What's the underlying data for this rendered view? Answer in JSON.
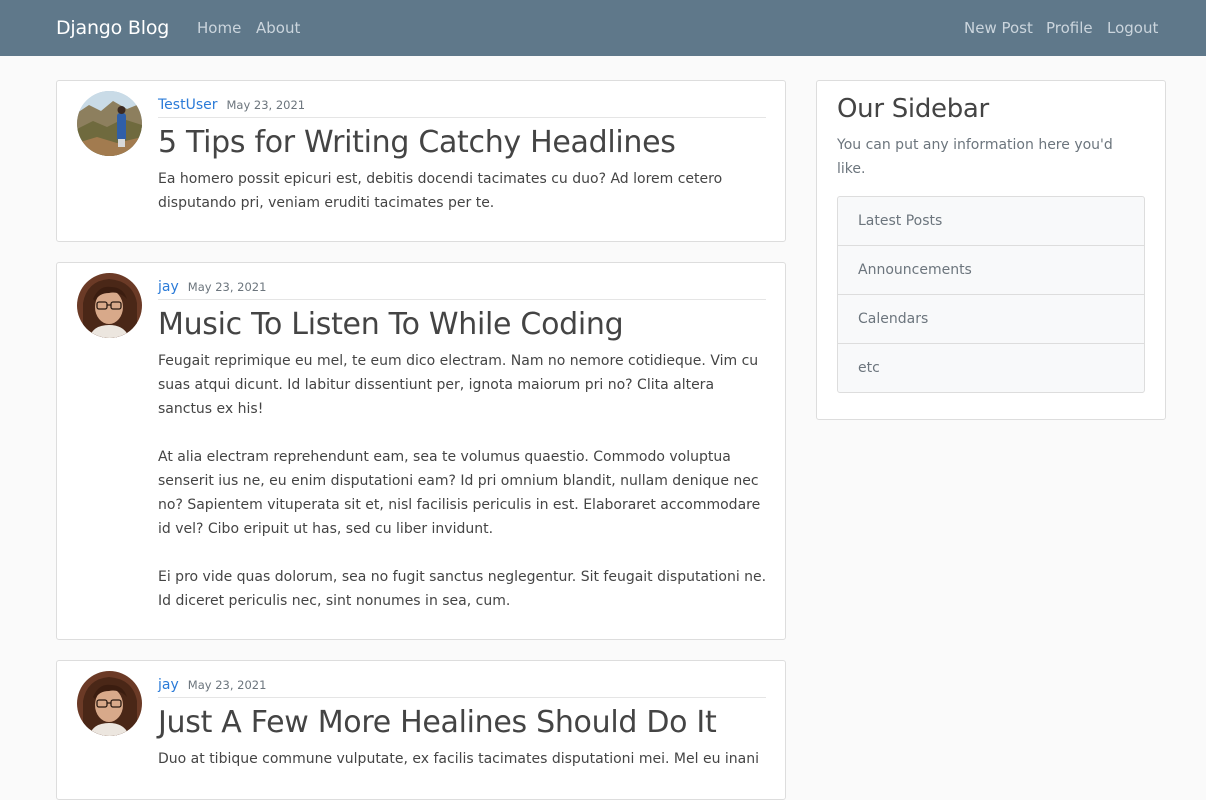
{
  "navbar": {
    "brand": "Django Blog",
    "left_links": [
      "Home",
      "About"
    ],
    "right_links": [
      "New Post",
      "Profile",
      "Logout"
    ]
  },
  "posts": [
    {
      "author": "TestUser",
      "date": "May 23, 2021",
      "title": "5 Tips for Writing Catchy Headlines",
      "paragraphs": [
        "Ea homero possit epicuri est, debitis docendi tacimates cu duo? Ad lorem cetero disputando pri, veniam eruditi tacimates per te."
      ]
    },
    {
      "author": "jay",
      "date": "May 23, 2021",
      "title": "Music To Listen To While Coding",
      "paragraphs": [
        "Feugait reprimique eu mel, te eum dico electram. Nam no nemore cotidieque. Vim cu suas atqui dicunt. Id labitur dissentiunt per, ignota maiorum pri no? Clita altera sanctus ex his!",
        "At alia electram reprehendunt eam, sea te volumus quaestio. Commodo voluptua senserit ius ne, eu enim disputationi eam? Id pri omnium blandit, nullam denique nec no? Sapientem vituperata sit et, nisl facilisis periculis in est. Elaboraret accommodare id vel? Cibo eripuit ut has, sed cu liber invidunt.",
        "Ei pro vide quas dolorum, sea no fugit sanctus neglegentur. Sit feugait disputationi ne. Id diceret periculis nec, sint nonumes in sea, cum."
      ]
    },
    {
      "author": "jay",
      "date": "May 23, 2021",
      "title": "Just A Few More Healines Should Do It",
      "paragraphs": [
        "Duo at tibique commune vulputate, ex facilis tacimates disputationi mei. Mel eu inani"
      ]
    }
  ],
  "sidebar": {
    "title": "Our Sidebar",
    "description": "You can put any information here you'd like.",
    "items": [
      "Latest Posts",
      "Announcements",
      "Calendars",
      "etc"
    ]
  },
  "colors": {
    "navbar_bg": "#5f788a",
    "link_blue": "#2b7bd8",
    "page_bg": "#fafafa"
  }
}
